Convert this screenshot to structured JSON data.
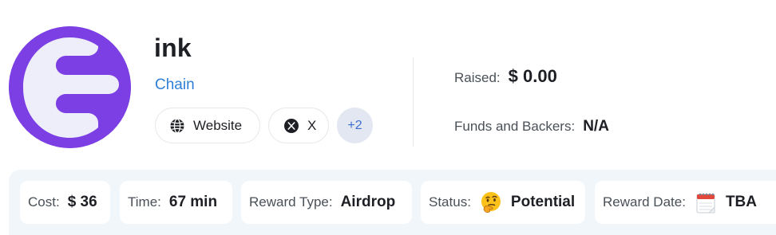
{
  "project": {
    "name": "ink",
    "category": "Chain",
    "logo_color": "#7b3fe4"
  },
  "links": [
    {
      "label": "Website",
      "icon": "globe-icon"
    },
    {
      "label": "X",
      "icon": "x-logo-icon"
    }
  ],
  "more_links": "+2",
  "stats": {
    "raised_label": "Raised:",
    "raised_value": "$ 0.00",
    "funds_label": "Funds and Backers:",
    "funds_value": "N/A"
  },
  "info": {
    "cost_label": "Cost:",
    "cost_value": "$ 36",
    "time_label": "Time:",
    "time_value": "67 min",
    "reward_type_label": "Reward Type:",
    "reward_type_value": "Airdrop",
    "status_label": "Status:",
    "status_icon": "thinking-face-icon",
    "status_value": "Potential",
    "reward_date_label": "Reward Date:",
    "reward_date_icon": "calendar-icon",
    "reward_date_value": "TBA"
  }
}
